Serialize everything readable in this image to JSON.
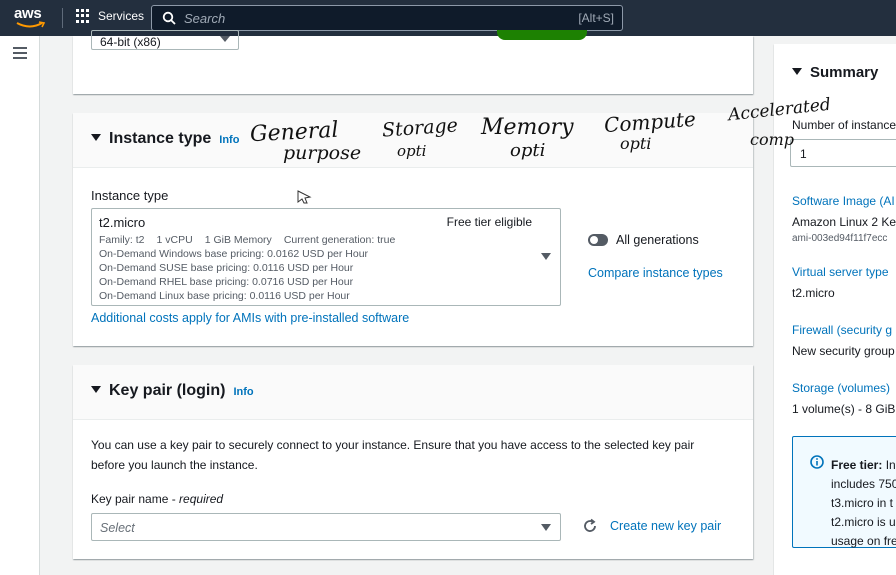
{
  "nav": {
    "logo": "aws",
    "services_label": "Services",
    "search_placeholder": "Search",
    "search_shortcut": "[Alt+S]"
  },
  "top_panel": {
    "architecture_value": "64-bit (x86)"
  },
  "instance_type": {
    "title": "Instance type",
    "info": "Info",
    "field_label": "Instance type",
    "selected": {
      "name": "t2.micro",
      "badge": "Free tier eligible",
      "family": "Family: t2",
      "vcpu": "1 vCPU",
      "memory": "1 GiB Memory",
      "generation": "Current generation: true",
      "pricing": [
        "On-Demand Windows base pricing: 0.0162 USD per Hour",
        "On-Demand SUSE base pricing: 0.0116 USD per Hour",
        "On-Demand RHEL base pricing: 0.0716 USD per Hour",
        "On-Demand Linux base pricing: 0.0116 USD per Hour"
      ]
    },
    "all_generations_label": "All generations",
    "compare_link": "Compare instance types",
    "additional_costs_link": "Additional costs apply for AMIs with pre-installed software"
  },
  "key_pair": {
    "title": "Key pair (login)",
    "info": "Info",
    "description": "You can use a key pair to securely connect to your instance. Ensure that you have access to the selected key pair before you launch the instance.",
    "name_label": "Key pair name - ",
    "required": "required",
    "select_placeholder": "Select",
    "create_link": "Create new key pair"
  },
  "summary": {
    "title": "Summary",
    "num_instances_label": "Number of instance",
    "num_instances_value": "1",
    "software_image_label": "Software Image (AI",
    "software_image_value": "Amazon Linux 2 Ke",
    "ami_id": "ami-003ed94f11f7ecc",
    "virtual_server_label": "Virtual server type",
    "virtual_server_value": "t2.micro",
    "firewall_label": "Firewall (security g",
    "firewall_value": "New security group",
    "storage_label": "Storage (volumes)",
    "storage_value": "1 volume(s) - 8 GiB",
    "free_tier": {
      "title": "Free tier:",
      "title_rest": " In",
      "lines": [
        "includes 750",
        "t3.micro in t",
        "t2.micro is u",
        "usage on fre"
      ]
    }
  },
  "annotations": {
    "general_1": "General",
    "general_2": "purpose",
    "storage_1": "Storage",
    "storage_2": "opti",
    "memory_1": "Memory",
    "memory_2": "opti",
    "compute_1": "Compute",
    "compute_2": "opti",
    "accelerated_1": "Accelerated",
    "accelerated_2": "comp"
  },
  "colors": {
    "nav_bg": "#232f3e",
    "link": "#0073bb",
    "launch_green": "#1d8102"
  }
}
